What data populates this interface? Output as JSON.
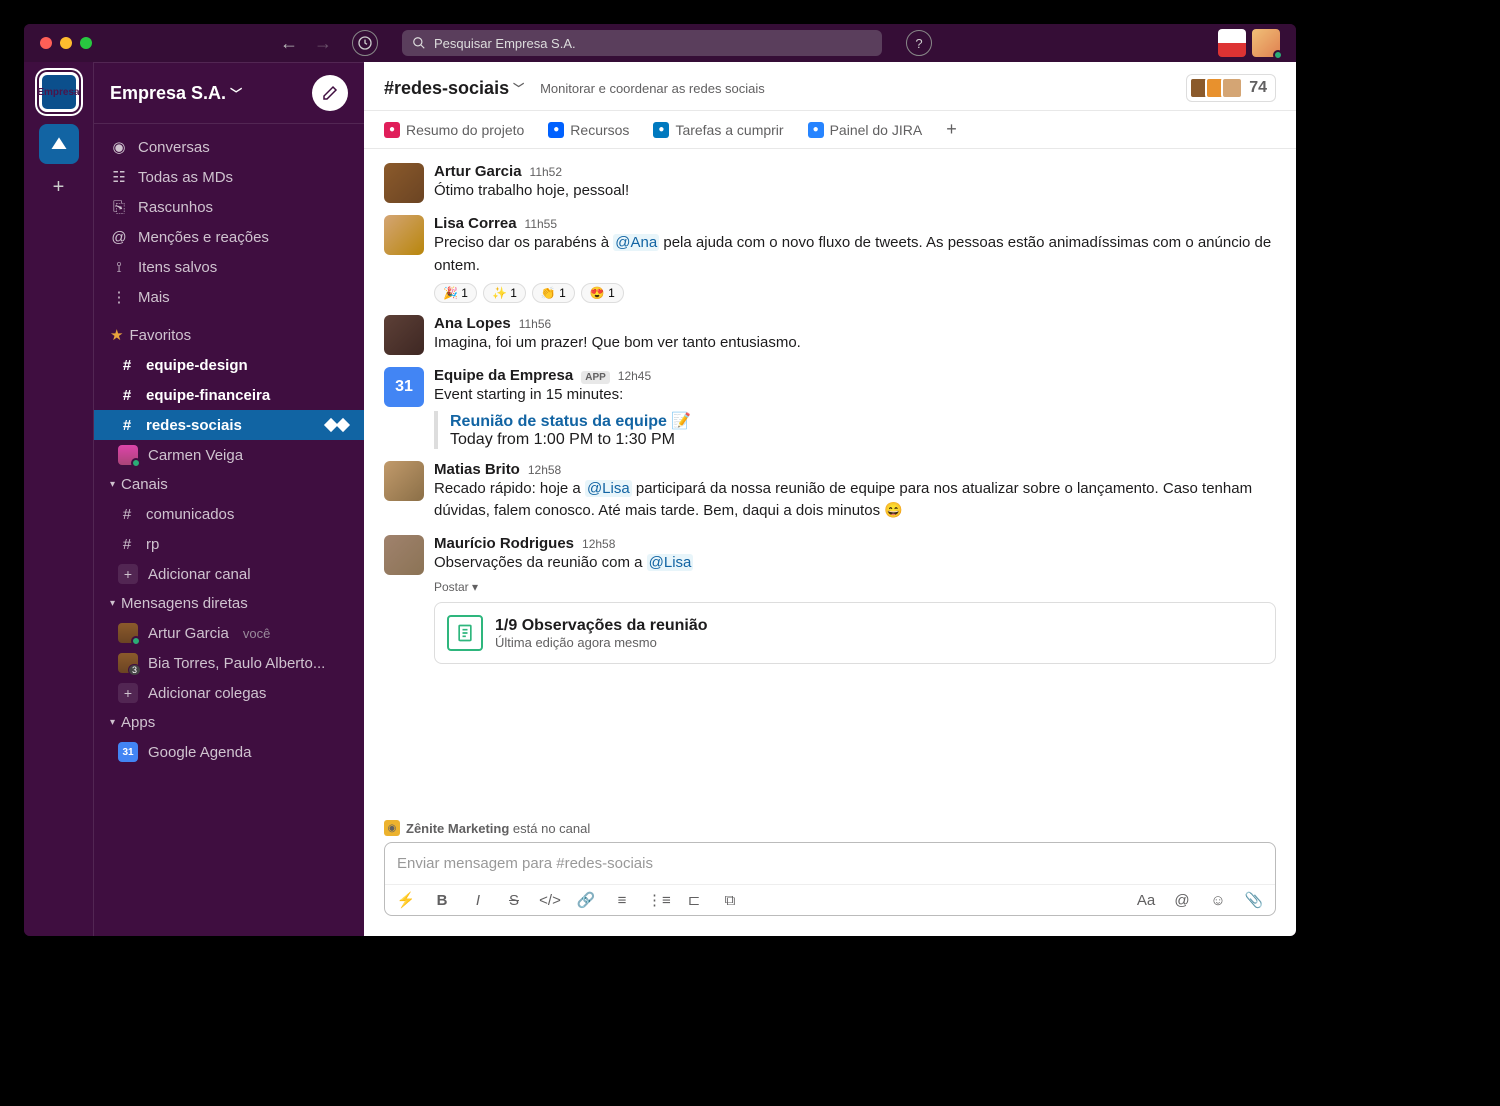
{
  "titlebar": {
    "search_placeholder": "Pesquisar Empresa S.A."
  },
  "rail": {
    "workspace_label": "Empresa"
  },
  "sidebar": {
    "workspace_name": "Empresa S.A.",
    "nav": {
      "threads": "Conversas",
      "dms": "Todas as MDs",
      "drafts": "Rascunhos",
      "mentions": "Menções e reações",
      "saved": "Itens salvos",
      "more": "Mais"
    },
    "favorites_label": "Favoritos",
    "favorites": [
      {
        "name": "equipe-design",
        "bold": true,
        "type": "channel"
      },
      {
        "name": "equipe-financeira",
        "bold": true,
        "type": "channel"
      },
      {
        "name": "redes-sociais",
        "bold": true,
        "type": "channel",
        "selected": true
      },
      {
        "name": "Carmen Veiga",
        "type": "dm"
      }
    ],
    "channels_label": "Canais",
    "channels": [
      {
        "name": "comunicados"
      },
      {
        "name": "rp"
      }
    ],
    "add_channel": "Adicionar canal",
    "dms_label": "Mensagens diretas",
    "dms": [
      {
        "name": "Artur Garcia",
        "you": "você"
      },
      {
        "name": "Bia Torres, Paulo Alberto...",
        "badge": "3"
      }
    ],
    "add_people": "Adicionar colegas",
    "apps_label": "Apps",
    "apps": [
      {
        "name": "Google Agenda"
      }
    ]
  },
  "header": {
    "channel_name": "#redes-sociais",
    "topic": "Monitorar e coordenar as redes sociais",
    "member_count": "74"
  },
  "bookmarks": [
    {
      "label": "Resumo do projeto",
      "color": "#e01e5a"
    },
    {
      "label": "Recursos",
      "color": "#0061fe"
    },
    {
      "label": "Tarefas a cumprir",
      "color": "#0079bf"
    },
    {
      "label": "Painel do JIRA",
      "color": "#2684ff"
    }
  ],
  "messages": [
    {
      "author": "Artur Garcia",
      "time": "11h52",
      "text": "Ótimo trabalho hoje, pessoal!",
      "avatar": "av-artur"
    },
    {
      "author": "Lisa Correa",
      "time": "11h55",
      "text_parts": [
        "Preciso dar os parabéns à ",
        "@Ana",
        " pela ajuda com o novo fluxo de tweets. As pessoas estão animadíssimas com o anúncio de ontem."
      ],
      "avatar": "av-lisa",
      "reactions": [
        {
          "emoji": "🎉",
          "count": "1"
        },
        {
          "emoji": "✨",
          "count": "1"
        },
        {
          "emoji": "👏",
          "count": "1"
        },
        {
          "emoji": "😍",
          "count": "1"
        }
      ]
    },
    {
      "author": "Ana Lopes",
      "time": "11h56",
      "text": "Imagina, foi um prazer! Que bom ver tanto entusiasmo.",
      "avatar": "av-ana"
    },
    {
      "author": "Equipe da Empresa",
      "app": "APP",
      "time": "12h45",
      "text": "Event starting in 15 minutes:",
      "avatar": "av-cal",
      "avatar_text": "31",
      "event": {
        "title": "Reunião de status da equipe 📝",
        "time": "Today from 1:00 PM to 1:30 PM"
      }
    },
    {
      "author": "Matias Brito",
      "time": "12h58",
      "text_parts": [
        "Recado rápido: hoje a ",
        "@Lisa",
        " participará da nossa reunião de equipe para nos atualizar sobre o lançamento. Caso tenham dúvidas, falem conosco. Até mais tarde. Bem, daqui a dois minutos 😄"
      ],
      "avatar": "av-matias"
    },
    {
      "author": "Maurício Rodrigues",
      "time": "12h58",
      "text_parts": [
        "Observações da reunião com a ",
        "@Lisa"
      ],
      "avatar": "av-mauricio",
      "post_label": "Postar",
      "post": {
        "title": "1/9 Observações da reunião",
        "subtitle": "Última edição agora mesmo"
      }
    }
  ],
  "channel_notice": {
    "app": "Zênite Marketing",
    "text": " está no canal"
  },
  "composer": {
    "placeholder": "Enviar mensagem para #redes-sociais"
  }
}
